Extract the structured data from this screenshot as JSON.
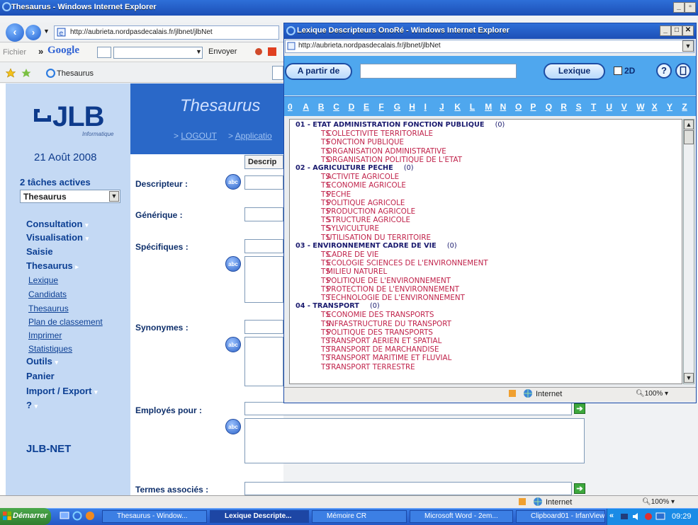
{
  "main_window": {
    "title": "Thesaurus - Windows Internet Explorer",
    "url": "http://aubrieta.nordpasdecalais.fr/jlbnet/jlbNet",
    "google_bar": {
      "fichier": "Fichier",
      "chevron": "»",
      "google": "Google",
      "envoyer": "Envoyer"
    },
    "tab": "Thesaurus",
    "status": {
      "zone": "Internet",
      "zoom": "100%"
    }
  },
  "page": {
    "logo": "JLB",
    "logo_sub": "Informatique",
    "date": "21 Août 2008",
    "banner_title": "Thesaurus",
    "logout": "LOGOUT",
    "application": "Applicatio",
    "tasks_label": "2 tâches actives",
    "tasks_select": "Thesaurus",
    "menu": [
      {
        "label": "Consultation",
        "arrow": "▾"
      },
      {
        "label": "Visualisation",
        "arrow": "▾"
      },
      {
        "label": "Saisie",
        "arrow": ""
      },
      {
        "label": "Thesaurus",
        "arrow": "▸"
      }
    ],
    "submenu": [
      "Lexique",
      "Candidats",
      "Thesaurus",
      "Plan de classement",
      "Imprimer",
      "Statistiques"
    ],
    "menu2": [
      {
        "label": "Outils",
        "arrow": "▾"
      },
      {
        "label": "Panier",
        "arrow": ""
      },
      {
        "label": "Import / Export",
        "arrow": "▾"
      },
      {
        "label": "?",
        "arrow": "▾"
      }
    ],
    "footer_brand": "JLB-NET",
    "tab_descrip": "Descrip",
    "form": {
      "descripteur": "Descripteur :",
      "generique": "Générique :",
      "specifiques": "Spécifiques :",
      "synonymes": "Synonymes :",
      "employes_pour": "Employés pour :",
      "termes_associes": "Termes associés :",
      "abc": "abc"
    }
  },
  "popup": {
    "title": "Lexique Descripteurs OnoRé - Windows Internet Explorer",
    "url": "http://aubrieta.nordpasdecalais.fr/jlbnet/jlbNet",
    "a_partir_de": "A partir de",
    "search_value": "",
    "lexique": "Lexique",
    "checkbox_2d": "2D",
    "help": "?",
    "alphabet": [
      "0",
      "A",
      "B",
      "C",
      "D",
      "E",
      "F",
      "G",
      "H",
      "I",
      "J",
      "K",
      "L",
      "M",
      "N",
      "O",
      "P",
      "Q",
      "R",
      "S",
      "T",
      "U",
      "V",
      "W",
      "X",
      "Y",
      "Z"
    ],
    "categories": [
      {
        "name": "01 - ETAT ADMINISTRATION FONCTION PUBLIQUE",
        "count": "(0)",
        "terms": [
          "COLLECTIVITE TERRITORIALE",
          "FONCTION PUBLIQUE",
          "ORGANISATION ADMINISTRATIVE",
          "ORGANISATION POLITIQUE DE L'ETAT"
        ]
      },
      {
        "name": "02 - AGRICULTURE PECHE",
        "count": "(0)",
        "terms": [
          "ACTIVITE AGRICOLE",
          "ECONOMIE AGRICOLE",
          "PECHE",
          "POLITIQUE AGRICOLE",
          "PRODUCTION AGRICOLE",
          "STRUCTURE AGRICOLE",
          "SYLVICULTURE",
          "UTILISATION DU TERRITOIRE"
        ]
      },
      {
        "name": "03 - ENVIRONNEMENT CADRE DE VIE",
        "count": "(0)",
        "terms": [
          "CADRE DE VIE",
          "ECOLOGIE SCIENCES DE L'ENVIRONNEMENT",
          "MILIEU NATUREL",
          "POLITIQUE DE L'ENVIRONNEMENT",
          "PROTECTION DE L'ENVIRONNEMENT",
          "TECHNOLOGIE DE L'ENVIRONNEMENT"
        ]
      },
      {
        "name": "04 - TRANSPORT",
        "count": "(0)",
        "terms": [
          "ECONOMIE DES TRANSPORTS",
          "INFRASTRUCTURE DU TRANSPORT",
          "POLITIQUE DES TRANSPORTS",
          "TRANSPORT AERIEN ET SPATIAL",
          "TRANSPORT DE MARCHANDISE",
          "TRANSPORT MARITIME ET FLUVIAL",
          "TRANSPORT TERRESTRE"
        ]
      }
    ],
    "ts": "TS",
    "status": {
      "zone": "Internet",
      "zoom": "100%"
    }
  },
  "taskbar": {
    "start": "Démarrer",
    "items": [
      "Thesaurus - Window...",
      "Lexique Descripte...",
      "Mémoire CR",
      "Microsoft Word - 2em...",
      "Clipboard01 - IrfanView"
    ],
    "collapse": "«",
    "clock": "09:29"
  },
  "colors": {
    "xp_blue": "#1c4fb6",
    "popup_blue": "#4fa7ee",
    "sidebar": "#c4d9f4",
    "term_red": "#c0224a"
  }
}
